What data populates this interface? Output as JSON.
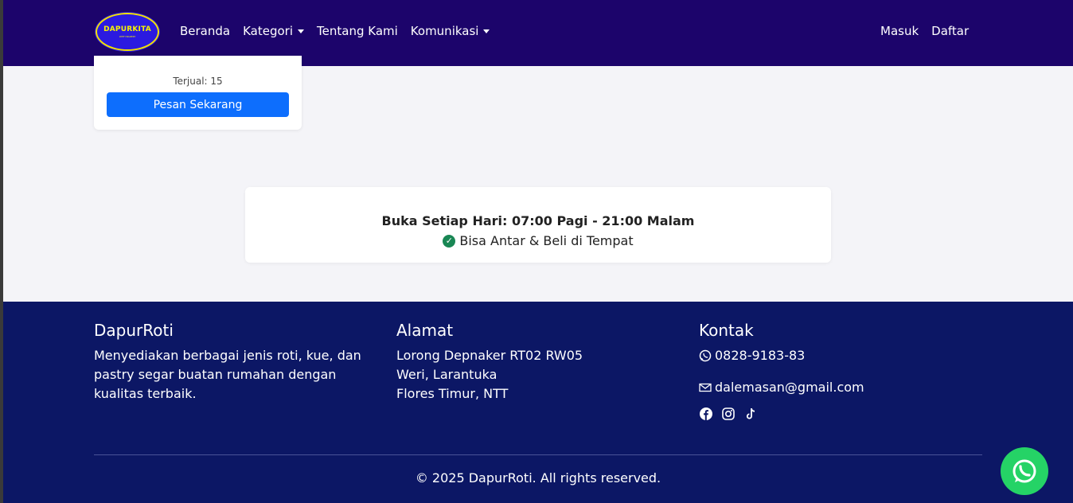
{
  "navbar": {
    "logo_text": "DAPURKITA",
    "logo_subtext": "WITH BAKERY",
    "links": [
      "Beranda",
      "Kategori",
      "Tentang Kami",
      "Komunikasi"
    ],
    "right_links": [
      "Masuk",
      "Daftar"
    ]
  },
  "product_card": {
    "sold_label": "Terjual: 15",
    "order_button": "Pesan Sekarang"
  },
  "hours": {
    "title": "Buka Setiap Hari: 07:00 Pagi - 21:00 Malam",
    "service": "Bisa Antar & Beli di Tempat"
  },
  "footer": {
    "about_title": "DapurRoti",
    "about_text": "Menyediakan berbagai jenis roti, kue, dan pastry segar buatan rumahan dengan kualitas terbaik.",
    "address_title": "Alamat",
    "address_lines": [
      "Lorong Depnaker RT02 RW05",
      "Weri, Larantuka",
      "Flores Timur, NTT"
    ],
    "contact_title": "Kontak",
    "phone": "0828-9183-83",
    "email": "dalemasan@gmail.com",
    "social_icons": [
      "facebook-icon",
      "instagram-icon",
      "tiktok-icon"
    ],
    "copyright": "© 2025 DapurRoti. All rights reserved."
  },
  "colors": {
    "navbar": "#1c046b",
    "footer": "#0c1765",
    "primary_button": "#0d6efd",
    "whatsapp": "#25d366",
    "check": "#198754"
  }
}
